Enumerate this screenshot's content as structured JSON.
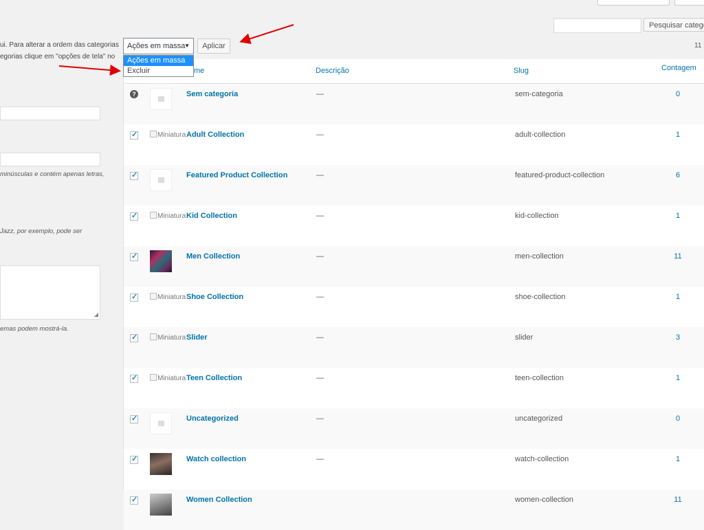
{
  "top": {
    "search_button": "Pesquisar categor",
    "hint_lines": [
      "ui. Para alterar a ordem das categorias",
      "egorias clique em \"opções de tela\" no"
    ],
    "slug_hint": "minúsculas e contém apenas letras,",
    "parent_hint": "Jazz, por exemplo, pode ser",
    "desc_hint": "emas podem mostrá-la."
  },
  "bulk": {
    "selected": "Ações em massa",
    "options": [
      "Ações em massa",
      "Excluir"
    ],
    "apply": "Aplicar",
    "count_text": "11"
  },
  "table": {
    "headers": {
      "name": "me",
      "description": "Descrição",
      "slug": "Slug",
      "count": "Contagem"
    },
    "alt_text": "Miniatura",
    "rows": [
      {
        "name": "Sem categoria",
        "description": "—",
        "slug": "sem-categoria",
        "count": "0",
        "thumb": "placeholder",
        "check": "help"
      },
      {
        "name": "Adult Collection",
        "description": "—",
        "slug": "adult-collection",
        "count": "1",
        "thumb": "broken",
        "check": "checked"
      },
      {
        "name": "Featured Product Collection",
        "description": "—",
        "slug": "featured-product-collection",
        "count": "6",
        "thumb": "placeholder",
        "check": "checked"
      },
      {
        "name": "Kid Collection",
        "description": "—",
        "slug": "kid-collection",
        "count": "1",
        "thumb": "broken",
        "check": "checked"
      },
      {
        "name": "Men Collection",
        "description": "—",
        "slug": "men-collection",
        "count": "11",
        "thumb": "image-men",
        "check": "checked"
      },
      {
        "name": "Shoe Collection",
        "description": "—",
        "slug": "shoe-collection",
        "count": "1",
        "thumb": "broken",
        "check": "checked"
      },
      {
        "name": "Slider",
        "description": "—",
        "slug": "slider",
        "count": "3",
        "thumb": "broken",
        "check": "checked"
      },
      {
        "name": "Teen Collection",
        "description": "—",
        "slug": "teen-collection",
        "count": "1",
        "thumb": "broken",
        "check": "checked"
      },
      {
        "name": "Uncategorized",
        "description": "—",
        "slug": "uncategorized",
        "count": "0",
        "thumb": "placeholder",
        "check": "checked"
      },
      {
        "name": "Watch collection",
        "description": "—",
        "slug": "watch-collection",
        "count": "1",
        "thumb": "image-watch",
        "check": "checked"
      },
      {
        "name": "Women Collection",
        "description": "",
        "slug": "women-collection",
        "count": "11",
        "thumb": "image-women",
        "check": "checked"
      }
    ]
  },
  "colors": {
    "link": "#0073aa",
    "highlight": "#1e90ff",
    "annotation": "#e00000"
  }
}
